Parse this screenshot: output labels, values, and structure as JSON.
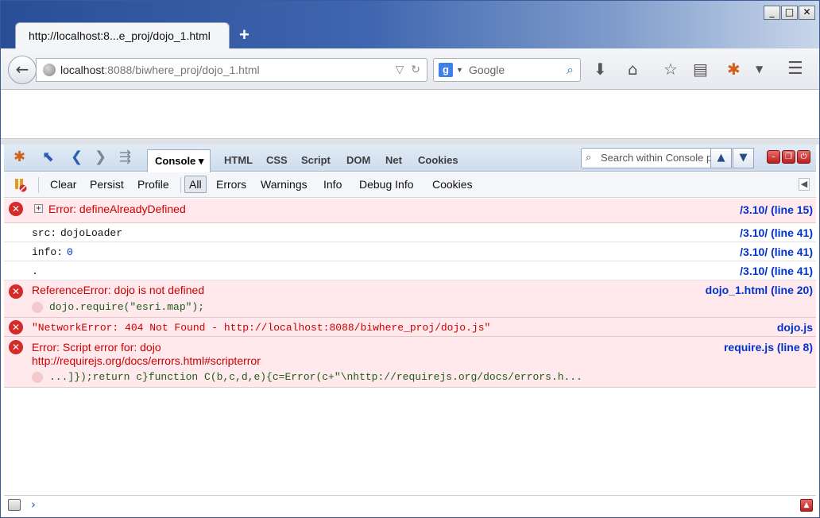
{
  "window": {
    "minimize": "_",
    "maximize": "□",
    "close": "✕"
  },
  "tab": {
    "title": "http://localhost:8...e_proj/dojo_1.html",
    "new_tab": "+"
  },
  "navbar": {
    "url_host": "localhost",
    "url_rest": ":8088/biwhere_proj/dojo_1.html",
    "search_placeholder": "Google"
  },
  "firebug": {
    "panels": [
      "Console",
      "HTML",
      "CSS",
      "Script",
      "DOM",
      "Net",
      "Cookies"
    ],
    "active_panel": "Console",
    "search_placeholder": "Search within Console panel",
    "console_buttons": {
      "clear": "Clear",
      "persist": "Persist",
      "profile": "Profile"
    },
    "filters": [
      "All",
      "Errors",
      "Warnings",
      "Info",
      "Debug Info",
      "Cookies"
    ],
    "active_filter": "All"
  },
  "log": [
    {
      "type": "error",
      "message": "Error: defineAlreadyDefined",
      "source": "/3.10/ (line 15)"
    },
    {
      "type": "plain",
      "key": "src:",
      "value": "dojoLoader",
      "source": "/3.10/ (line 41)"
    },
    {
      "type": "plain",
      "key": "info:",
      "value": "0",
      "source": "/3.10/ (line 41)"
    },
    {
      "type": "plain",
      "key": ".",
      "value": "",
      "source": "/3.10/ (line 41)"
    },
    {
      "type": "error",
      "message": "ReferenceError: dojo is not defined",
      "code": "dojo.require(\"esri.map\");",
      "source": "dojo_1.html (line 20)"
    },
    {
      "type": "error",
      "message": "\"NetworkError: 404 Not Found - http://localhost:8088/biwhere_proj/dojo.js\"",
      "source": "dojo.js"
    },
    {
      "type": "error",
      "message": "Error: Script error for: dojo",
      "message2": "http://requirejs.org/docs/errors.html#scripterror",
      "code": "...]});return c}function C(b,c,d,e){c=Error(c+\"\\nhttp://requirejs.org/docs/errors.h...",
      "source": "require.js (line 8)"
    }
  ],
  "cmdline": {
    "prompt": "›"
  }
}
